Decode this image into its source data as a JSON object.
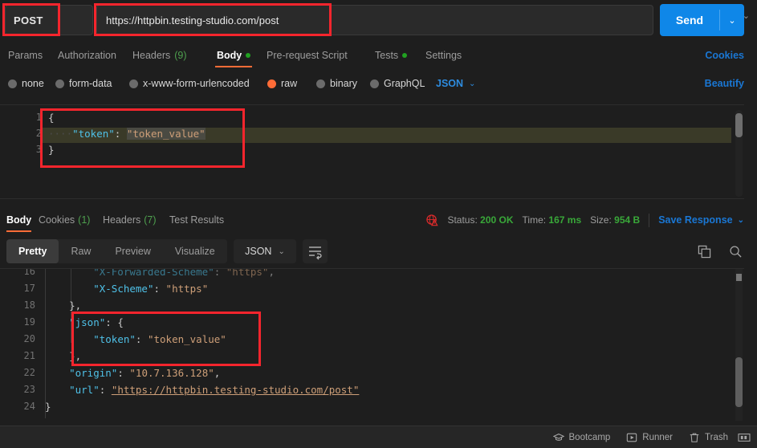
{
  "request": {
    "method": "POST",
    "method_caret_icon": "chevron-down-icon",
    "url": "https://httpbin.testing-studio.com/post",
    "send_label": "Send",
    "send_caret_icon": "chevron-down-icon",
    "tabs": [
      {
        "label": "Params",
        "count": "",
        "dot": false,
        "active": false
      },
      {
        "label": "Authorization",
        "count": "",
        "dot": false,
        "active": false
      },
      {
        "label": "Headers",
        "count": "(9)",
        "dot": false,
        "active": false
      },
      {
        "label": "Body",
        "count": "",
        "dot": true,
        "active": true
      },
      {
        "label": "Pre-request Script",
        "count": "",
        "dot": false,
        "active": false
      },
      {
        "label": "Tests",
        "count": "",
        "dot": true,
        "active": false
      },
      {
        "label": "Settings",
        "count": "",
        "dot": false,
        "active": false
      }
    ],
    "cookies_link": "Cookies",
    "body_types": [
      {
        "label": "none",
        "selected": false
      },
      {
        "label": "form-data",
        "selected": false
      },
      {
        "label": "x-www-form-urlencoded",
        "selected": false
      },
      {
        "label": "raw",
        "selected": true
      },
      {
        "label": "binary",
        "selected": false
      },
      {
        "label": "GraphQL",
        "selected": false
      }
    ],
    "format_selected": "JSON",
    "format_caret_icon": "chevron-down-icon",
    "beautify_label": "Beautify",
    "editor_lines": [
      {
        "num": "1",
        "text": "{"
      },
      {
        "num": "2",
        "text": "    \"token\": \"token_value\""
      },
      {
        "num": "3",
        "text": "}"
      }
    ],
    "editor_body_key": "\"token\"",
    "editor_body_value": "\"token_value\""
  },
  "response": {
    "tabs": [
      {
        "label": "Body",
        "count": "",
        "active": true
      },
      {
        "label": "Cookies",
        "count": "(1)",
        "active": false
      },
      {
        "label": "Headers",
        "count": "(7)",
        "active": false
      },
      {
        "label": "Test Results",
        "count": "",
        "active": false
      }
    ],
    "warning_icon": "globe-warning-icon",
    "status_label": "Status:",
    "status_value": "200 OK",
    "time_label": "Time:",
    "time_value": "167 ms",
    "size_label": "Size:",
    "size_value": "954 B",
    "save_response_label": "Save Response",
    "save_response_caret_icon": "chevron-down-icon",
    "view_modes": [
      {
        "label": "Pretty",
        "active": true
      },
      {
        "label": "Raw",
        "active": false
      },
      {
        "label": "Preview",
        "active": false
      },
      {
        "label": "Visualize",
        "active": false
      }
    ],
    "format_selected": "JSON",
    "format_caret_icon": "chevron-down-icon",
    "wrap_icon": "word-wrap-icon",
    "copy_icon": "copy-icon",
    "search_icon": "search-icon",
    "body_lines": [
      {
        "num": "16",
        "text": "        \"X-Forwarded-Scheme\": \"https\","
      },
      {
        "num": "17",
        "text": "        \"X-Scheme\": \"https\""
      },
      {
        "num": "18",
        "text": "    },"
      },
      {
        "num": "19",
        "text": "    \"json\": {"
      },
      {
        "num": "20",
        "text": "        \"token\": \"token_value\""
      },
      {
        "num": "21",
        "text": "    },"
      },
      {
        "num": "22",
        "text": "    \"origin\": \"10.7.136.128\","
      },
      {
        "num": "23",
        "text": "    \"url\": \"https://httpbin.testing-studio.com/post\""
      },
      {
        "num": "24",
        "text": "}"
      }
    ],
    "frag": {
      "k_xscheme": "\"X-Scheme\"",
      "v_https": "\"https\"",
      "k_json": "\"json\"",
      "k_token": "\"token\"",
      "v_token": "\"token_value\"",
      "k_origin": "\"origin\"",
      "v_origin": "\"10.7.136.128\"",
      "k_url": "\"url\"",
      "v_url": "\"https://httpbin.testing-studio.com/post\"",
      "brace_open": "{",
      "brace_close": "}",
      "close_comma": "},",
      "colon": ": ",
      "comma": ","
    }
  },
  "bottom_bar": {
    "items": [
      {
        "label": "Bootcamp",
        "icon": "graduation-cap-icon"
      },
      {
        "label": "Runner",
        "icon": "play-square-icon"
      },
      {
        "label": "Trash",
        "icon": "trash-icon"
      }
    ],
    "panel_icon": "layout-panel-icon"
  },
  "colors": {
    "accent_orange": "#ff6c37",
    "link_blue": "#1a77d4",
    "send_blue": "#0f87e8",
    "status_green": "#39a839",
    "annotation_red": "#f5252d",
    "background": "#1e1e1e"
  }
}
